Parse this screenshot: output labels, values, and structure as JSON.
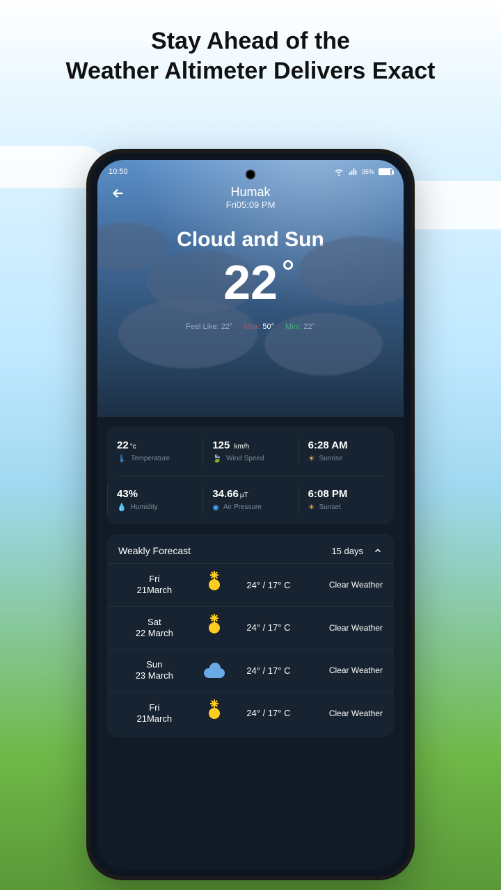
{
  "promo": {
    "line1": "Stay Ahead of the",
    "line2": "Weather Altimeter Delivers Exact"
  },
  "statusbar": {
    "time": "10:50",
    "battery_text": "95%"
  },
  "header": {
    "location": "Humak",
    "datetime": "Fri05:09 PM"
  },
  "current": {
    "condition": "Cloud and Sun",
    "temp": "22",
    "feel_label": "Feel Like:",
    "feel_value": "22°",
    "max_label": "Max:",
    "max_value": "50°",
    "min_label": "Mini:",
    "min_value": "22°"
  },
  "metrics": {
    "temperature": {
      "value": "22",
      "unit": "°c",
      "label": "Temperature"
    },
    "wind": {
      "value": "125",
      "unit": "km/h",
      "label": "Wind Speed"
    },
    "sunrise": {
      "value": "6:28 AM",
      "label": "Sunrise"
    },
    "humidity": {
      "value": "43%",
      "label": "Humidity"
    },
    "pressure": {
      "value": "34.66",
      "unit": "µT",
      "label": "Air Pressure"
    },
    "sunset": {
      "value": "6:08 PM",
      "label": "Sunset"
    }
  },
  "forecast": {
    "title": "Weakly Forecast",
    "range": "15 days",
    "rows": [
      {
        "dow": "Fri",
        "date": "21March",
        "icon": "sun",
        "temps": "24° / 17° C",
        "cond": "Clear Weather"
      },
      {
        "dow": "Sat",
        "date": "22 March",
        "icon": "sun",
        "temps": "24° / 17° C",
        "cond": "Clear Weather"
      },
      {
        "dow": "Sun",
        "date": "23 March",
        "icon": "cloud",
        "temps": "24° / 17° C",
        "cond": "Clear Weather"
      },
      {
        "dow": "Fri",
        "date": "21March",
        "icon": "sun",
        "temps": "24° / 17° C",
        "cond": "Clear Weather"
      }
    ]
  }
}
